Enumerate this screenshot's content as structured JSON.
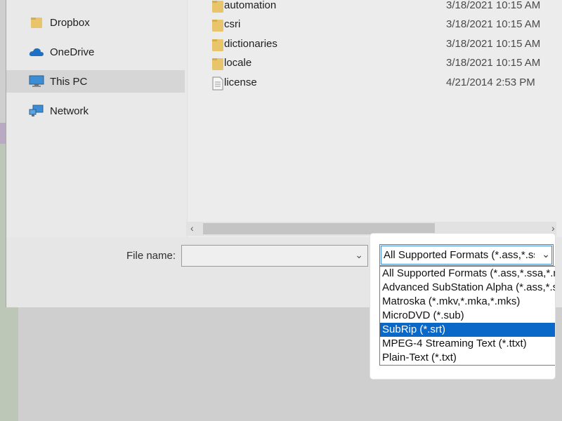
{
  "navigation": {
    "items": [
      {
        "label": "Dropbox",
        "icon": "folder-icon"
      },
      {
        "label": "OneDrive",
        "icon": "cloud-icon"
      },
      {
        "label": "This PC",
        "icon": "computer-icon",
        "selected": true
      },
      {
        "label": "Network",
        "icon": "network-icon"
      }
    ]
  },
  "files": [
    {
      "name": "automation",
      "date": "3/18/2021 10:15 AM",
      "type": "folder"
    },
    {
      "name": "csri",
      "date": "3/18/2021 10:15 AM",
      "type": "folder"
    },
    {
      "name": "dictionaries",
      "date": "3/18/2021 10:15 AM",
      "type": "folder"
    },
    {
      "name": "locale",
      "date": "3/18/2021 10:15 AM",
      "type": "folder"
    },
    {
      "name": "license",
      "date": "4/21/2014 2:53 PM",
      "type": "file"
    }
  ],
  "filename": {
    "label": "File name:",
    "value": ""
  },
  "filetype": {
    "selected": "All Supported Formats (*.ass,*.ssa,*.mks)",
    "options": [
      "All Supported Formats (*.ass,*.ssa,*.mks)",
      "Advanced SubStation Alpha (*.ass,*.ssa)",
      "Matroska (*.mkv,*.mka,*.mks)",
      "MicroDVD (*.sub)",
      "SubRip (*.srt)",
      "MPEG-4 Streaming Text (*.ttxt)",
      "Plain-Text (*.txt)"
    ],
    "highlighted_index": 4
  },
  "colors": {
    "highlight": "#0a68c8",
    "folder": "#e8c46a",
    "focus_outline": "#3c8ee0"
  }
}
